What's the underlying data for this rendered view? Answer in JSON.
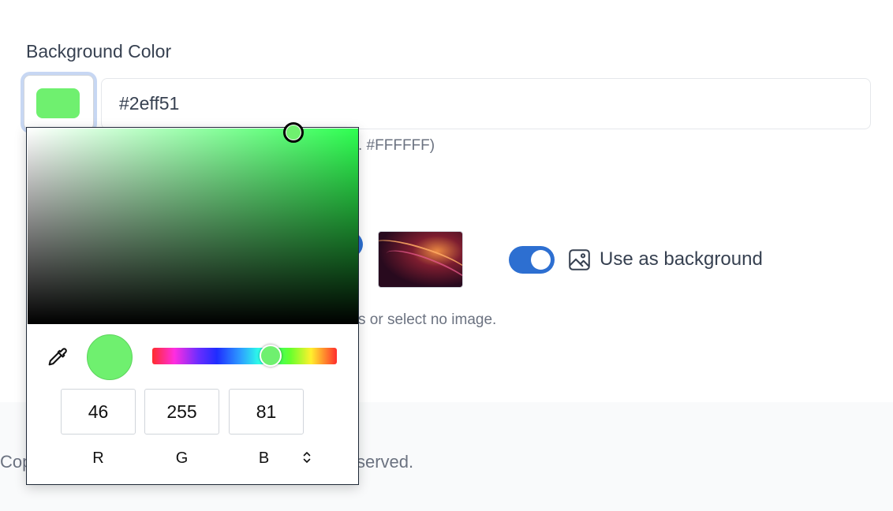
{
  "field": {
    "label": "Background Color",
    "hex_value": "#2eff51",
    "helper_visible": ". #FFFFFF)"
  },
  "swatch": {
    "color": "#6ff06f"
  },
  "background_image": {
    "toggle_label": "Use as background",
    "toggle_on": true,
    "helper_visible": "s or select no image."
  },
  "footer": {
    "left_fragment": "Cop",
    "right_fragment": "served."
  },
  "picker": {
    "hue_color": "#2eff51",
    "r": "46",
    "g": "255",
    "b": "81",
    "labels": {
      "r": "R",
      "g": "G",
      "b": "B"
    },
    "icons": [
      "eyedropper-icon",
      "swap-mode-icon"
    ]
  },
  "colors": {
    "accent": "#2d6fd1",
    "selected_color": "#2eff51"
  }
}
